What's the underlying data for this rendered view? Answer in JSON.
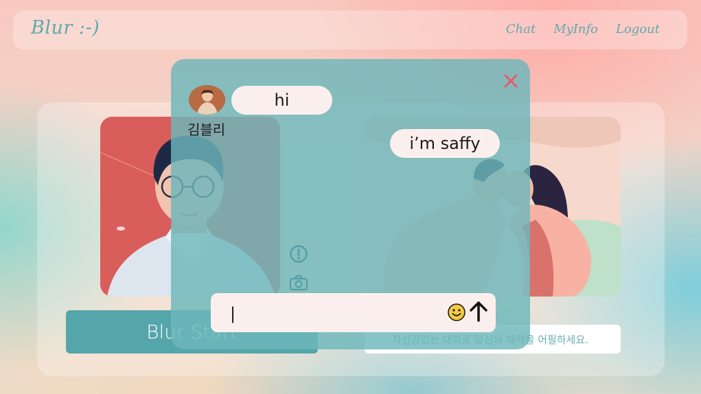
{
  "navbar": {
    "logo": "Blur :-)",
    "links": [
      {
        "label": "Chat"
      },
      {
        "label": "MyInfo"
      },
      {
        "label": "Logout"
      }
    ]
  },
  "main": {
    "start_button": "Blur Start",
    "hint": "자신감있는 대화로 당신의 매력을 어필하세요."
  },
  "chat": {
    "partner_name": "김블리",
    "messages": [
      {
        "side": "left",
        "text": "hi"
      },
      {
        "side": "right",
        "text": "i’m saffy"
      }
    ],
    "input_value": "|",
    "icons": {
      "close": "close-icon",
      "alert": "alert-icon",
      "camera": "camera-icon",
      "emoji": "smiley-icon",
      "send": "arrow-up-icon"
    }
  },
  "colors": {
    "accent": "#55a6aa",
    "close": "#e65a6e",
    "bubble": "#fbefed"
  }
}
